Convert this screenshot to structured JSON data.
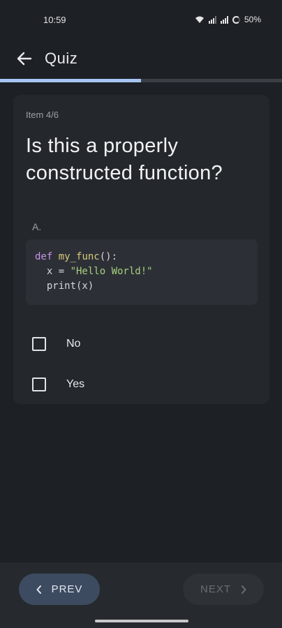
{
  "status": {
    "time": "10:59",
    "battery": "50%",
    "icons": [
      "wifi-icon",
      "signal-icon",
      "signal-icon",
      "battery-icon"
    ]
  },
  "app_bar": {
    "title": "Quiz",
    "back_icon": "arrow-left-icon"
  },
  "progress": {
    "fraction": 0.5,
    "color": "#a6c4f2"
  },
  "question": {
    "counter": "Item 4/6",
    "text": "Is this a properly constructed function?",
    "option_letter": "A.",
    "code": {
      "line1_keyword": "def",
      "line1_name": "my_func",
      "line1_rest": "():",
      "line2_prefix": "  x = ",
      "line2_string": "\"Hello World!\"",
      "line3": "  print(x)"
    }
  },
  "answers": [
    {
      "label": "No",
      "checked": false
    },
    {
      "label": "Yes",
      "checked": false
    }
  ],
  "navigation": {
    "prev_label": "PREV",
    "next_label": "NEXT",
    "next_enabled": false
  },
  "colors": {
    "background": "#1d2025",
    "card": "#24282d",
    "accent": "#a6c4f2",
    "prev_button": "#3d4b60"
  }
}
